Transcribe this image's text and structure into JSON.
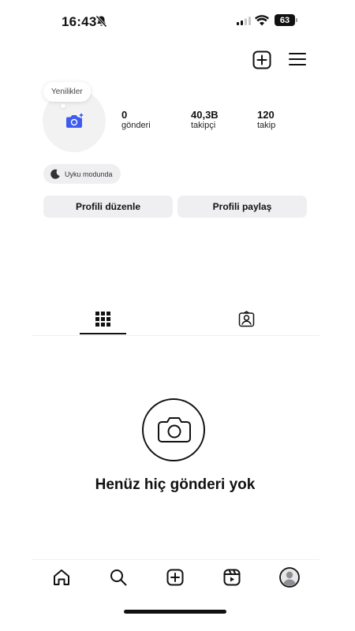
{
  "status_bar": {
    "time": "16:43",
    "battery": "63",
    "icons": [
      "bell-slash-icon",
      "signal-icon",
      "wifi-icon",
      "battery-icon"
    ]
  },
  "header": {
    "icons": [
      "add-square-icon",
      "menu-icon"
    ]
  },
  "profile": {
    "notes_bubble": "Yenilikler",
    "stats": {
      "posts": {
        "value": "0",
        "label": "gönderi"
      },
      "followers": {
        "value": "40,3B",
        "label": "takipçi"
      },
      "following": {
        "value": "120",
        "label": "takip"
      }
    },
    "status_chip": "Uyku modunda",
    "edit_button": "Profili düzenle",
    "share_button": "Profili paylaş"
  },
  "tabs": {
    "items": [
      "grid-icon",
      "tagged-icon"
    ],
    "active": "grid-icon"
  },
  "empty_state": {
    "icon": "camera-icon",
    "text": "Henüz hiç gönderi yok"
  },
  "bottom_nav": {
    "items": [
      "home-icon",
      "search-icon",
      "create-icon",
      "reels-icon",
      "profile-icon"
    ]
  },
  "colors": {
    "accent": "#3e5bf0",
    "chip_background": "#efeff1",
    "text": "#111111"
  }
}
